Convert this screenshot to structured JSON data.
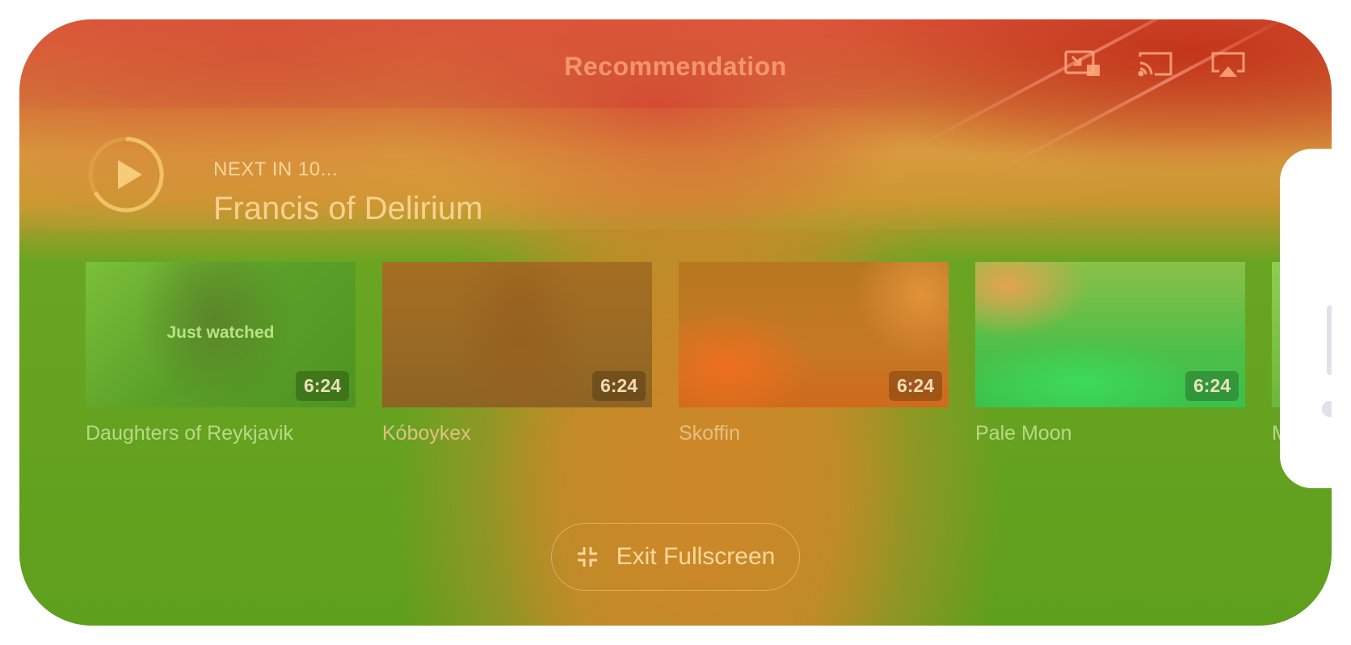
{
  "header": {
    "title": "Recommendation",
    "icons": [
      "picture-in-picture-icon",
      "cast-icon",
      "airplay-icon"
    ]
  },
  "up_next": {
    "label": "NEXT IN 10...",
    "title": "Francis of Delirium",
    "icon": "play-icon"
  },
  "recommendations": [
    {
      "title": "Daughters of Reykjavik",
      "duration": "6:24",
      "overlay": "Just watched"
    },
    {
      "title": "Kóboykex",
      "duration": "6:24"
    },
    {
      "title": "Skoffin",
      "duration": "6:24"
    },
    {
      "title": "Pale Moon",
      "duration": "6:24"
    },
    {
      "title": "M q",
      "duration": ""
    }
  ],
  "exit_fullscreen": {
    "label": "Exit Fullscreen",
    "icon": "exit-fullscreen-icon"
  },
  "colors": {
    "heat_hot": "#d44a34",
    "heat_warm": "#c98a2a",
    "heat_cool": "#5c9c1e"
  }
}
